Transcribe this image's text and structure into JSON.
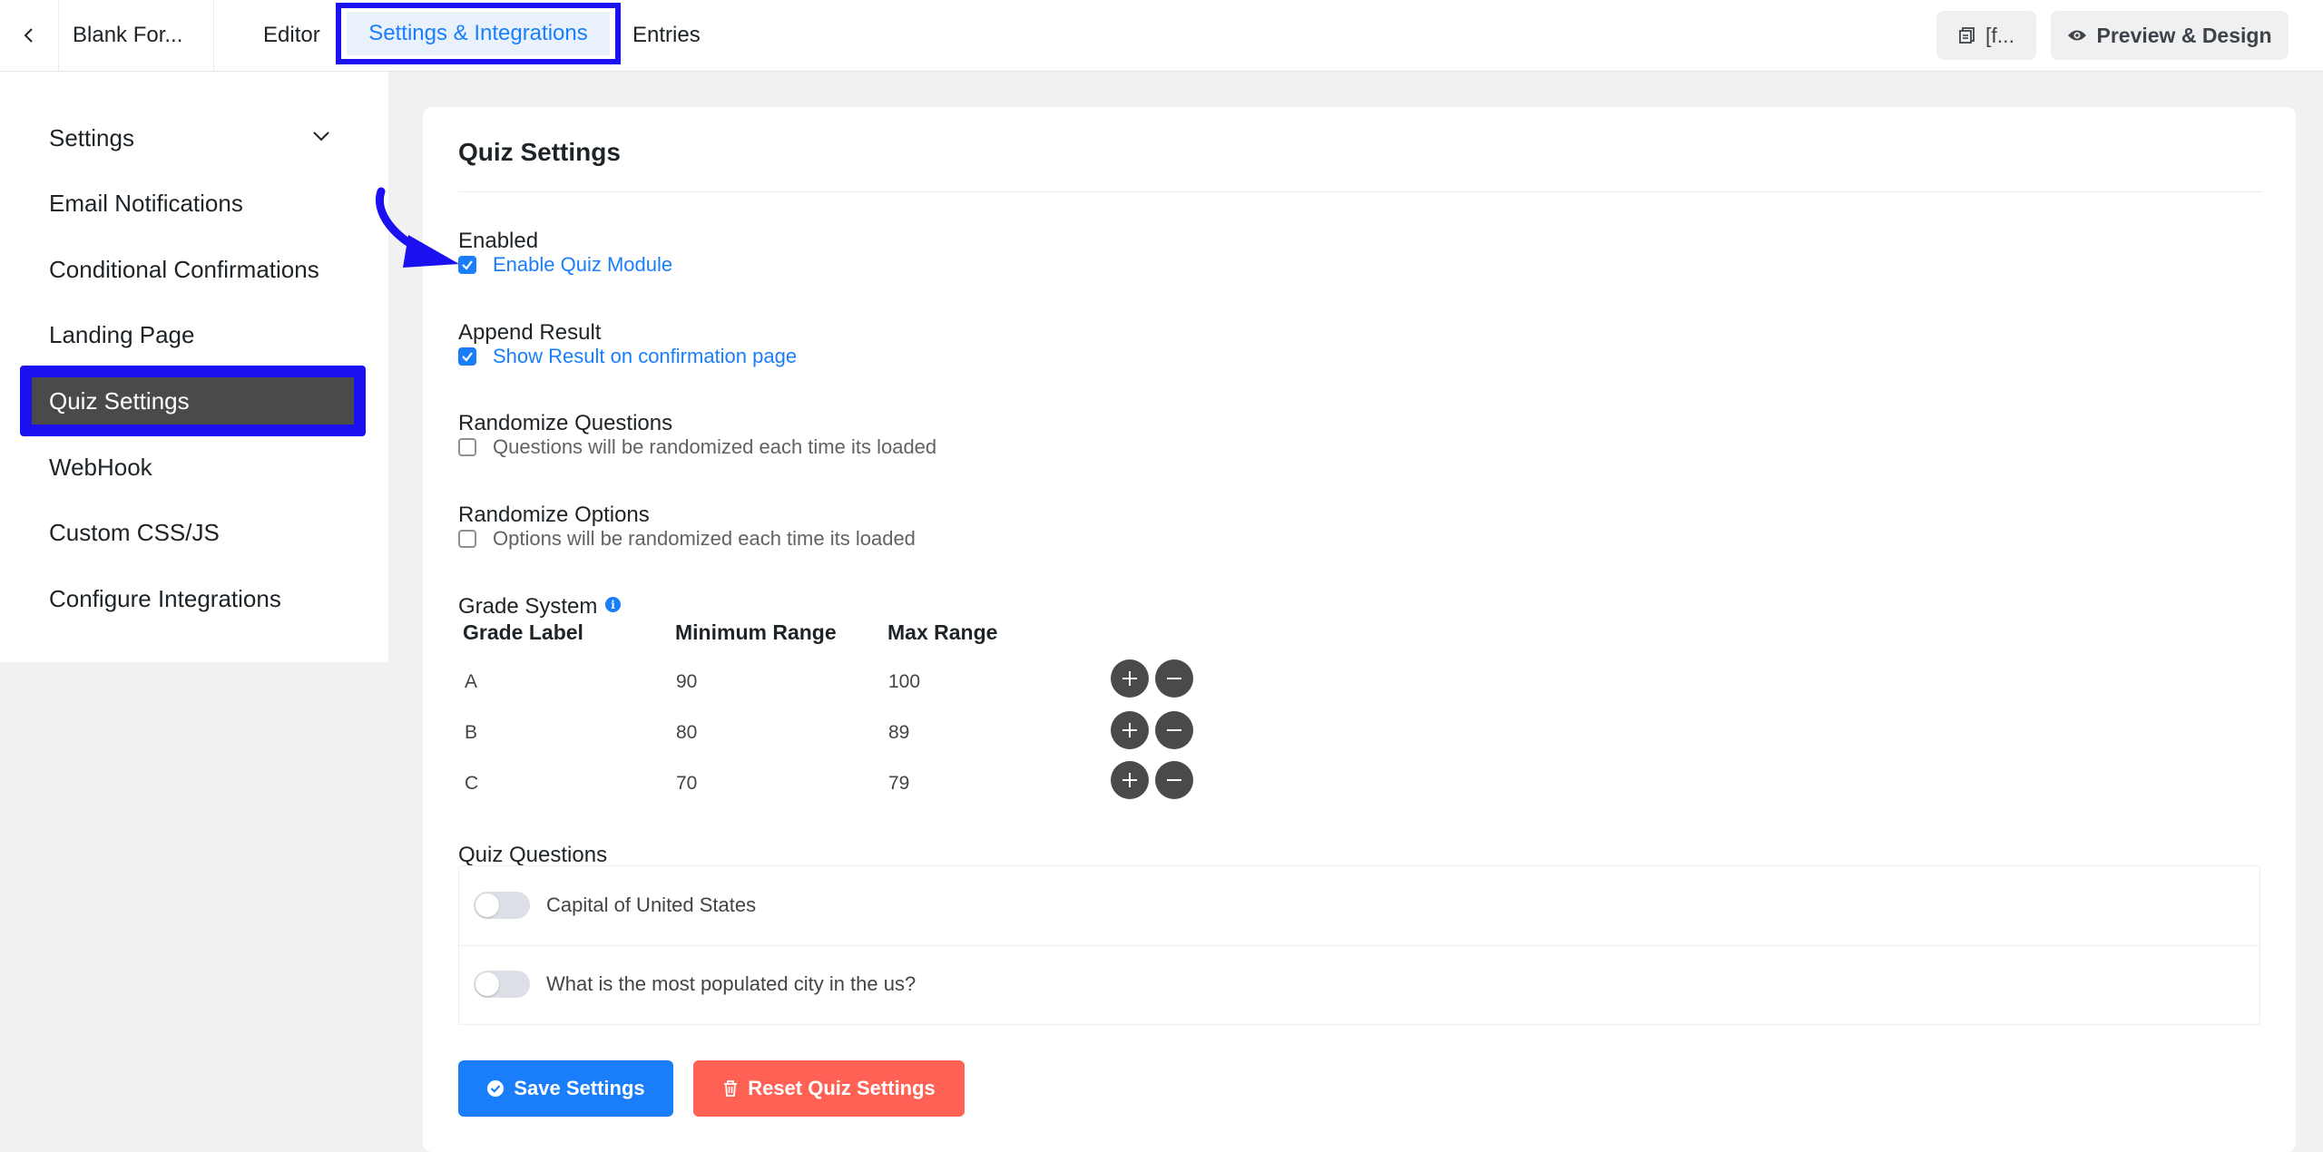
{
  "header": {
    "form_title": "Blank For...",
    "tabs": [
      {
        "label": "Editor"
      },
      {
        "label": "Settings & Integrations",
        "active": true
      },
      {
        "label": "Entries"
      }
    ],
    "shortcode_label": "[f...",
    "preview_label": "Preview & Design"
  },
  "sidebar": {
    "items": [
      {
        "label": "Settings"
      },
      {
        "label": "Email Notifications"
      },
      {
        "label": "Conditional Confirmations"
      },
      {
        "label": "Landing Page"
      },
      {
        "label": "Quiz Settings",
        "active": true
      },
      {
        "label": "WebHook"
      },
      {
        "label": "Custom CSS/JS"
      },
      {
        "label": "Configure Integrations"
      }
    ]
  },
  "main": {
    "title": "Quiz Settings",
    "enabled": {
      "label": "Enabled",
      "option": "Enable Quiz Module",
      "checked": true
    },
    "append_result": {
      "label": "Append Result",
      "option": "Show Result on confirmation page",
      "checked": true
    },
    "randomize_questions": {
      "label": "Randomize Questions",
      "option": "Questions will be randomized each time its loaded",
      "checked": false
    },
    "randomize_options": {
      "label": "Randomize Options",
      "option": "Options will be randomized each time its loaded",
      "checked": false
    },
    "grade_system": {
      "label": "Grade System",
      "info_icon": "i",
      "columns": [
        "Grade Label",
        "Minimum Range",
        "Max Range"
      ],
      "rows": [
        {
          "label": "A",
          "min": "90",
          "max": "100"
        },
        {
          "label": "B",
          "min": "80",
          "max": "89"
        },
        {
          "label": "C",
          "min": "70",
          "max": "79"
        }
      ]
    },
    "quiz_questions": {
      "label": "Quiz Questions",
      "items": [
        {
          "text": "Capital of United States",
          "enabled": false
        },
        {
          "text": "What is the most populated city in the us?",
          "enabled": false
        }
      ]
    },
    "buttons": {
      "save": "Save Settings",
      "reset": "Reset Quiz Settings"
    }
  },
  "colors": {
    "accent": "#1a7efb",
    "highlight_frame": "#1a10f0",
    "reset": "#ff6154",
    "active_nav_bg": "#4a4a4a"
  }
}
